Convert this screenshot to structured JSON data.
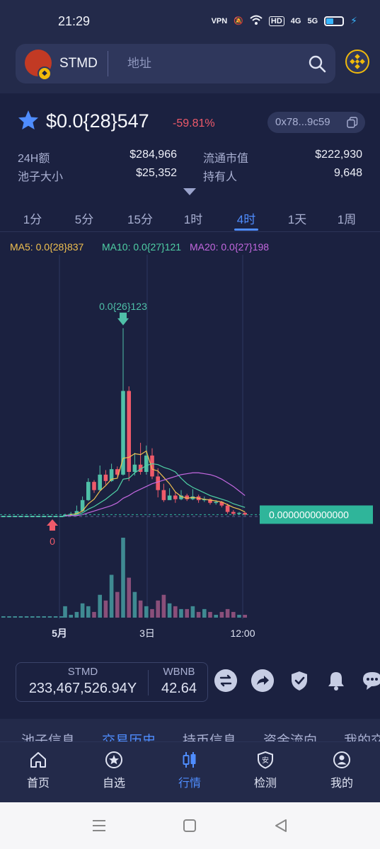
{
  "status_bar": {
    "time": "21:29",
    "icons": [
      "VPN",
      "mute",
      "wifi",
      "HD",
      "4G",
      "5G"
    ]
  },
  "header": {
    "token_symbol": "STMD",
    "search_placeholder": "地址",
    "chain": "BNB"
  },
  "token": {
    "price": "$0.0{28}547",
    "change": "-59.81%",
    "address": "0x78...9c59",
    "change_color": "#ef5a6a"
  },
  "stats": [
    {
      "label": "24H额",
      "value": "$284,966"
    },
    {
      "label": "流通市值",
      "value": "$222,930"
    },
    {
      "label": "池子大小",
      "value": "$25,352"
    },
    {
      "label": "持有人",
      "value": "9,648"
    }
  ],
  "intervals": [
    {
      "label": "1分",
      "active": false
    },
    {
      "label": "5分",
      "active": false
    },
    {
      "label": "15分",
      "active": false
    },
    {
      "label": "1时",
      "active": false
    },
    {
      "label": "4时",
      "active": true
    },
    {
      "label": "1天",
      "active": false
    },
    {
      "label": "1周",
      "active": false
    }
  ],
  "chart_data": {
    "type": "candlestick",
    "ma_legend": [
      {
        "label": "MA5: 0.0{28}837",
        "color": "#f0c050"
      },
      {
        "label": "MA10: 0.0{27}121",
        "color": "#4fd1a5"
      },
      {
        "label": "MA20: 0.0{27}198",
        "color": "#c468e0"
      }
    ],
    "x_ticks": [
      "5月",
      "3日",
      "12:00"
    ],
    "max_label": "0.0{26}123",
    "min_label": "0",
    "current_price_label": "0.0000000000000",
    "colors": {
      "up": "#4fc0a8",
      "down": "#ef5a6a",
      "current_price": "#2fb59a"
    },
    "candles": [
      {
        "o": 0,
        "c": 0.2,
        "h": 0.3,
        "l": 0
      },
      {
        "o": 0.2,
        "c": 0.3,
        "h": 0.5,
        "l": 0.1
      },
      {
        "o": 0.3,
        "c": 0.6,
        "h": 1.2,
        "l": 0.3
      },
      {
        "o": 0.6,
        "c": 1.8,
        "h": 2.2,
        "l": 0.5
      },
      {
        "o": 1.8,
        "c": 3.8,
        "h": 4.2,
        "l": 1.7
      },
      {
        "o": 3.8,
        "c": 2.9,
        "h": 4.0,
        "l": 2.6
      },
      {
        "o": 2.9,
        "c": 4.6,
        "h": 5.6,
        "l": 2.8
      },
      {
        "o": 4.6,
        "c": 3.9,
        "h": 5.1,
        "l": 3.5
      },
      {
        "o": 3.9,
        "c": 5.2,
        "h": 5.8,
        "l": 3.8
      },
      {
        "o": 5.2,
        "c": 4.6,
        "h": 5.5,
        "l": 4.4
      },
      {
        "o": 4.6,
        "c": 13.8,
        "h": 20.7,
        "l": 4.5
      },
      {
        "o": 13.8,
        "c": 4.9,
        "h": 14.3,
        "l": 3.9
      },
      {
        "o": 4.9,
        "c": 5.7,
        "h": 7.0,
        "l": 4.5
      },
      {
        "o": 5.7,
        "c": 4.9,
        "h": 8.1,
        "l": 4.6
      },
      {
        "o": 4.9,
        "c": 6.7,
        "h": 7.8,
        "l": 4.6
      },
      {
        "o": 6.7,
        "c": 4.4,
        "h": 7.5,
        "l": 4.1
      },
      {
        "o": 4.4,
        "c": 2.9,
        "h": 5.3,
        "l": 2.1
      },
      {
        "o": 2.9,
        "c": 1.8,
        "h": 3.6,
        "l": 1.6
      },
      {
        "o": 1.8,
        "c": 2.3,
        "h": 3.1,
        "l": 1.9
      },
      {
        "o": 2.3,
        "c": 1.9,
        "h": 2.7,
        "l": 1.5
      },
      {
        "o": 1.9,
        "c": 2.3,
        "h": 2.9,
        "l": 1.8
      },
      {
        "o": 2.3,
        "c": 1.9,
        "h": 2.5,
        "l": 1.7
      },
      {
        "o": 1.9,
        "c": 2.2,
        "h": 3.0,
        "l": 1.8
      },
      {
        "o": 2.2,
        "c": 1.8,
        "h": 2.4,
        "l": 1.5
      },
      {
        "o": 1.8,
        "c": 1.9,
        "h": 2.2,
        "l": 1.6
      },
      {
        "o": 1.9,
        "c": 1.5,
        "h": 2.0,
        "l": 1.3
      },
      {
        "o": 1.5,
        "c": 1.6,
        "h": 1.8,
        "l": 1.3
      },
      {
        "o": 1.6,
        "c": 1.2,
        "h": 1.7,
        "l": 1.0
      },
      {
        "o": 1.2,
        "c": 0.5,
        "h": 1.4,
        "l": 0.3
      },
      {
        "o": 0.5,
        "c": 0.3,
        "h": 0.7,
        "l": 0.1
      },
      {
        "o": 0.3,
        "c": 0.4,
        "h": 0.5,
        "l": 0.2
      },
      {
        "o": 0.4,
        "c": 0.2,
        "h": 0.5,
        "l": 0.1
      }
    ],
    "volume": [
      4,
      1,
      2,
      5,
      4,
      2,
      8,
      6,
      15,
      9,
      28,
      14,
      9,
      6,
      4,
      3,
      6,
      8,
      5,
      4,
      3,
      3,
      4,
      2,
      3,
      2,
      1,
      2,
      3,
      2,
      1,
      1
    ],
    "ma5": [
      0.1,
      0.2,
      0.3,
      0.6,
      1.4,
      1.9,
      2.8,
      3.4,
      4.1,
      4.2,
      6.4,
      6.5,
      6.9,
      6.8,
      7.2,
      5.2,
      5.0,
      4.3,
      3.6,
      2.7,
      2.2,
      2.0,
      2.1,
      2.0,
      1.9,
      1.8,
      1.7,
      1.6,
      1.3,
      1.0,
      0.8,
      0.5
    ],
    "ma10": [
      0.1,
      0.1,
      0.2,
      0.4,
      0.8,
      1.1,
      1.5,
      1.9,
      2.4,
      2.9,
      4.1,
      4.2,
      4.8,
      5.2,
      5.6,
      5.8,
      5.7,
      5.4,
      5.2,
      4.9,
      4.2,
      3.6,
      3.2,
      2.9,
      2.6,
      2.3,
      2.1,
      1.9,
      1.7,
      1.4,
      1.2,
      1.0
    ],
    "ma20": [
      0.1,
      0.1,
      0.1,
      0.2,
      0.4,
      0.6,
      0.8,
      1.0,
      1.2,
      1.5,
      2.0,
      2.3,
      2.7,
      3.0,
      3.3,
      3.6,
      3.8,
      4.0,
      4.2,
      4.4,
      4.6,
      4.7,
      4.8,
      4.8,
      4.7,
      4.6,
      4.4,
      4.1,
      3.7,
      3.3,
      2.8,
      2.3
    ]
  },
  "swap": {
    "left_symbol": "STMD",
    "left_amount": "233,467,526.94Y",
    "right_symbol": "WBNB",
    "right_amount": "42.64"
  },
  "sub_tabs": [
    {
      "label": "池子信息",
      "active": false
    },
    {
      "label": "交易历史",
      "active": true
    },
    {
      "label": "持币信息",
      "active": false
    },
    {
      "label": "资金流向",
      "active": false
    },
    {
      "label": "我的交",
      "active": false
    }
  ],
  "bottom_nav": [
    {
      "label": "首页",
      "icon": "home-icon",
      "active": false
    },
    {
      "label": "自选",
      "icon": "star-circle-icon",
      "active": false
    },
    {
      "label": "行情",
      "icon": "candles-icon",
      "active": true
    },
    {
      "label": "检测",
      "icon": "shield-check-icon",
      "active": false
    },
    {
      "label": "我的",
      "icon": "user-icon",
      "active": false
    }
  ],
  "colors": {
    "accent": "#4f8dff",
    "bg": "#1b2140",
    "bnb": "#f0b90b"
  }
}
